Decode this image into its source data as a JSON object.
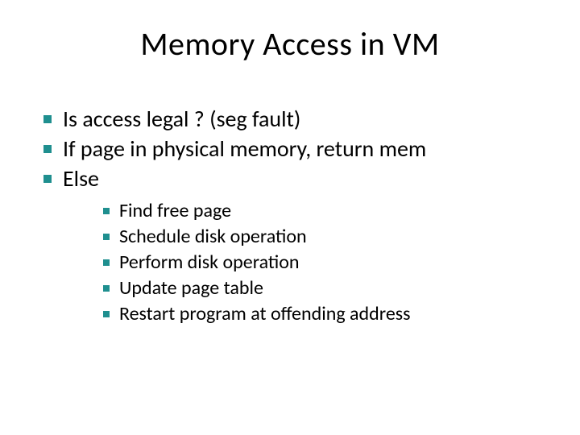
{
  "title": "Memory Access in VM",
  "bullets": {
    "b0": "Is access legal ?  (seg fault)",
    "b1": "If page in physical memory, return mem",
    "b2": "Else",
    "sub": {
      "s0": "Find free page",
      "s1": "Schedule disk operation",
      "s2": "Perform disk operation",
      "s3": "Update page table",
      "s4": "Restart program at offending address"
    }
  }
}
